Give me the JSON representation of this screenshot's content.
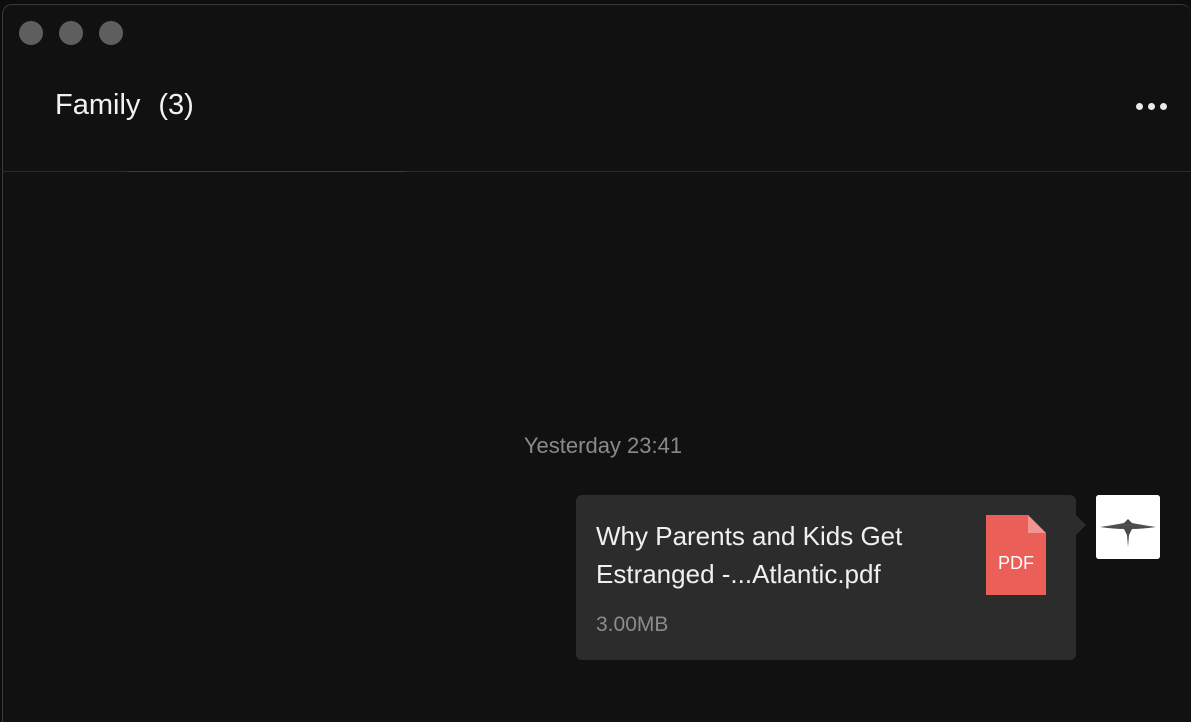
{
  "window": {
    "controls": [
      "close",
      "minimize",
      "zoom"
    ]
  },
  "header": {
    "title": "Family",
    "count": "(3)",
    "more_icon": "more-horizontal-icon"
  },
  "messages": [
    {
      "timestamp": "Yesterday 23:41",
      "file": {
        "name": "Why Parents and Kids Get Estranged -...Atlantic.pdf",
        "size": "3.00MB",
        "type_label": "PDF",
        "icon": "pdf-file-icon",
        "icon_color": "#ea5f57"
      },
      "sender_avatar": "avatar-image"
    }
  ],
  "colors": {
    "background": "#111111",
    "bubble": "#2c2c2c",
    "pdf_red": "#ea5f57"
  }
}
